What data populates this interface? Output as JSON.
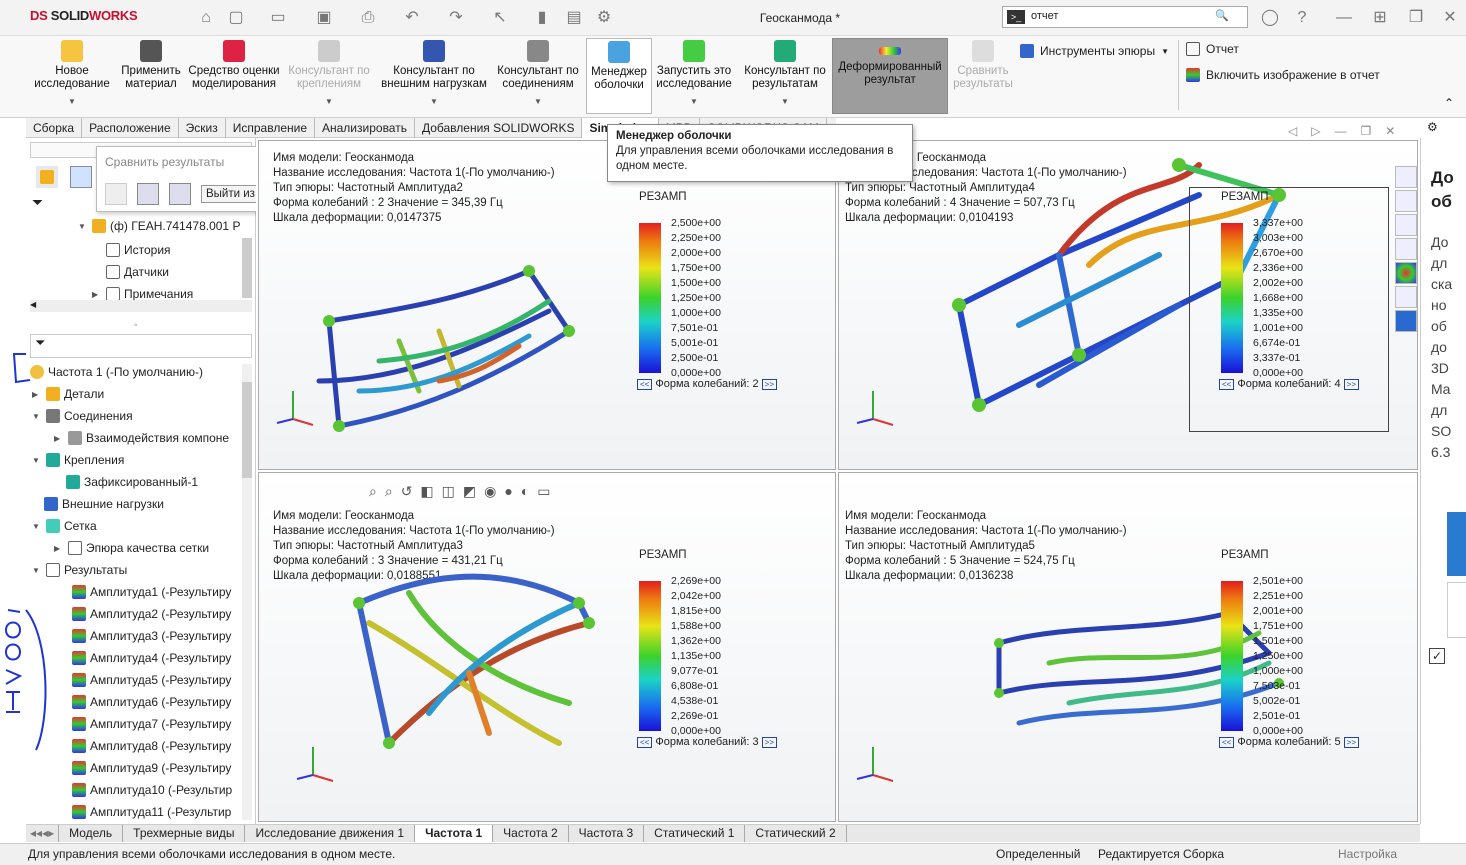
{
  "app": {
    "brand_a": "DS",
    "brand_b": "SOLID",
    "brand_c": "WORKS",
    "window_title": "Геосканмода *",
    "search_value": "отчет",
    "search_prefix": ">_"
  },
  "ribbon": {
    "new_study": "Новое исследование",
    "apply_material": "Применить материал",
    "mesh_quality": "Средство оценки моделирования",
    "fixture_advisor": "Консультант по креплениям",
    "load_advisor": "Консультант по внешним нагрузкам",
    "connection_advisor": "Консультант по соединениям",
    "shell_manager": "Менеджер оболочки",
    "run_study": "Запустить это исследование",
    "results_advisor": "Консультант по результатам",
    "deformed_result": "Деформированный результат",
    "compare_results": "Сравнить результаты",
    "plot_tools": "Инструменты эпюры",
    "report": "Отчет",
    "include_image": "Включить изображение в отчет"
  },
  "tabs": [
    "Сборка",
    "Расположение",
    "Эскиз",
    "Исправление",
    "Анализировать",
    "Добавления SOLIDWORKS",
    "Simulation",
    "MBD",
    "SOLIDWORKS CAM"
  ],
  "tooltip": {
    "title": "Менеджер оболочки",
    "text": "Для управления всеми оболочками исследования в одном месте."
  },
  "compare_panel": {
    "title": "Сравнить результаты",
    "exit": "Выйти из сравнения"
  },
  "tree_top": [
    {
      "label": "(ф) ГЕАН.741478.001 Р"
    },
    {
      "label": "История"
    },
    {
      "label": "Датчики"
    },
    {
      "label": "Примечания"
    }
  ],
  "tree": [
    {
      "label": "Частота 1 (-По умолчанию-)"
    },
    {
      "label": "Детали"
    },
    {
      "label": "Соединения"
    },
    {
      "label": "Взаимодействия компоне"
    },
    {
      "label": "Крепления"
    },
    {
      "label": "Зафиксированный-1"
    },
    {
      "label": "Внешние нагрузки"
    },
    {
      "label": "Сетка"
    },
    {
      "label": "Эпюра качества сетки"
    },
    {
      "label": "Результаты"
    },
    {
      "label": "Амплитуда1 (-Результиру"
    },
    {
      "label": "Амплитуда2 (-Результиру"
    },
    {
      "label": "Амплитуда3 (-Результиру"
    },
    {
      "label": "Амплитуда4 (-Результиру"
    },
    {
      "label": "Амплитуда5 (-Результиру"
    },
    {
      "label": "Амплитуда6 (-Результиру"
    },
    {
      "label": "Амплитуда7 (-Результиру"
    },
    {
      "label": "Амплитуда8 (-Результиру"
    },
    {
      "label": "Амплитуда9 (-Результиру"
    },
    {
      "label": "Амплитуда10 (-Результир"
    },
    {
      "label": "Амплитуда11 (-Результир"
    }
  ],
  "panes": [
    {
      "l1": "Имя модели: Геосканмода",
      "l2": "Название исследования: Частота 1(-По умолчанию-)",
      "l3": "Тип эпюры: Частотный Амплитуда2",
      "l4": "Форма колебаний : 2  Значение =        345,39 Гц",
      "l5": "Шкала деформации: 0,0147375",
      "legend_title": "РЕЗАМП",
      "ticks": [
        "2,500e+00",
        "2,250e+00",
        "2,000e+00",
        "1,750e+00",
        "1,500e+00",
        "1,250e+00",
        "1,000e+00",
        "7,501e-01",
        "5,001e-01",
        "2,500e-01",
        "0,000e+00"
      ],
      "mode": "Форма колебаний: 2"
    },
    {
      "l1": "Имя модели: Геосканмода",
      "l2": "Название исследования: Частота 1(-По умолчанию-)",
      "l3": "Тип эпюры: Частотный Амплитуда4",
      "l4": "Форма колебаний : 4  Значение =        507,73 Гц",
      "l5": "Шкала деформации: 0,0104193",
      "legend_title": "РЕЗАМП",
      "ticks": [
        "3,337e+00",
        "3,003e+00",
        "2,670e+00",
        "2,336e+00",
        "2,002e+00",
        "1,668e+00",
        "1,335e+00",
        "1,001e+00",
        "6,674e-01",
        "3,337e-01",
        "0,000e+00"
      ],
      "mode": "Форма колебаний: 4"
    },
    {
      "l1": "Имя модели: Геосканмода",
      "l2": "Название исследования: Частота 1(-По умолчанию-)",
      "l3": "Тип эпюры: Частотный Амплитуда3",
      "l4": "Форма колебаний : 3  Значение =        431,21 Гц",
      "l5": "Шкала деформации: 0,0188551",
      "legend_title": "РЕЗАМП",
      "ticks": [
        "2,269e+00",
        "2,042e+00",
        "1,815e+00",
        "1,588e+00",
        "1,362e+00",
        "1,135e+00",
        "9,077e-01",
        "6,808e-01",
        "4,538e-01",
        "2,269e-01",
        "0,000e+00"
      ],
      "mode": "Форма колебаний: 3"
    },
    {
      "l1": "Имя модели: Геосканмода",
      "l2": "Название исследования: Частота 1(-По умолчанию-)",
      "l3": "Тип эпюры: Частотный Амплитуда5",
      "l4": "Форма колебаний : 5  Значение =        524,75 Гц",
      "l5": "Шкала деформации: 0,0136238",
      "legend_title": "РЕЗАМП",
      "ticks": [
        "2,501e+00",
        "2,251e+00",
        "2,001e+00",
        "1,751e+00",
        "1,501e+00",
        "1,250e+00",
        "1,000e+00",
        "7,503e-01",
        "5,002e-01",
        "2,501e-01",
        "0,000e+00"
      ],
      "mode": "Форма колебаний: 5"
    }
  ],
  "bottom_tabs": [
    "Модель",
    "Трехмерные виды",
    "Исследование движения 1",
    "Частота 1",
    "Частота 2",
    "Частота 3",
    "Статический 1",
    "Статический 2"
  ],
  "status": {
    "hint": "Для управления всеми оболочками исследования в одном месте.",
    "defined": "Определенный",
    "editing": "Редактируется Сборка",
    "settings": "Настройка"
  },
  "taskpane": [
    "До",
    "об",
    "До",
    "дл",
    "ска",
    "но",
    "об",
    "до",
    "3D",
    "Ma",
    "дл",
    "SO",
    "6.3"
  ],
  "colors": {
    "accent": "#c8102e",
    "ribbon_active": "#9d9d9d"
  }
}
